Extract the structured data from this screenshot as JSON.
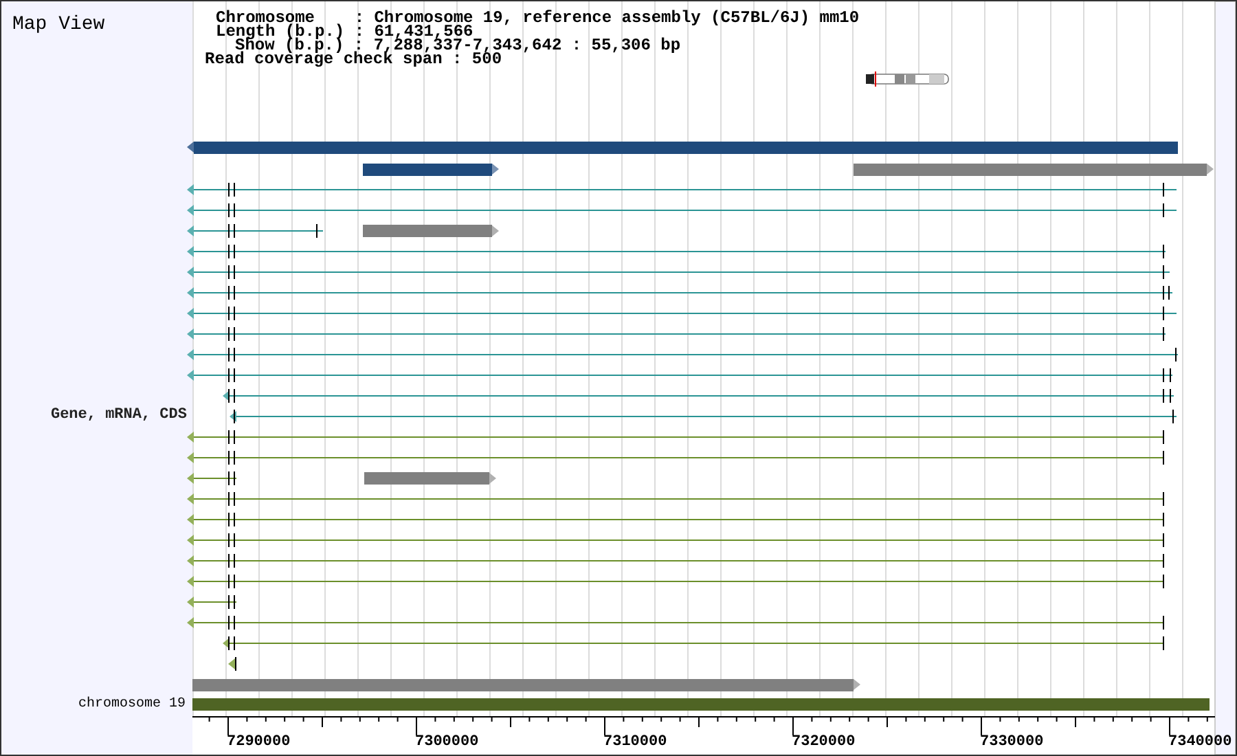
{
  "title": "Map View",
  "info": [
    "Chromosome    : Chromosome 19, reference assembly (C57BL/6J) mm10",
    "Length (b.p.) : 61,431,566",
    "Show (b.p.) : 7,288,337-7,343,642 : 55,306 bp",
    "Read coverage check span : 500"
  ],
  "tracks": [
    {
      "label": "Gene, mRNA, CDS"
    },
    {
      "label": "chromosome 19"
    }
  ],
  "axis": {
    "ticks": [
      "7290000",
      "7300000",
      "7310000",
      "7320000",
      "7330000",
      "7340000"
    ]
  }
}
